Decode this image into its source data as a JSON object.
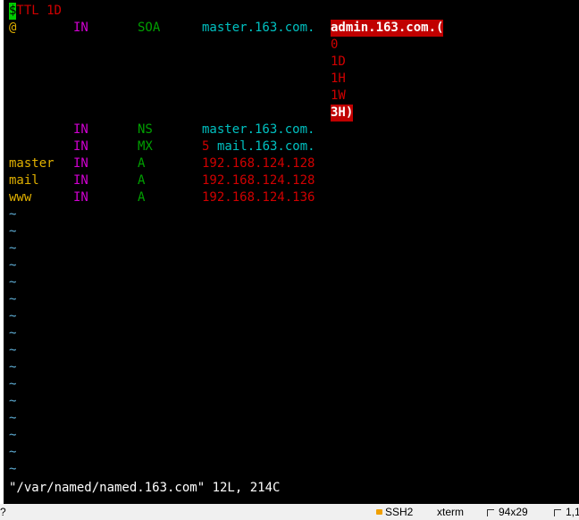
{
  "colors": {
    "background": "#000000",
    "yellow": "#e0b000",
    "magenta": "#d000d0",
    "green": "#00a000",
    "cyan": "#00c0c0",
    "red": "#d00000",
    "tilde": "#5fafd7",
    "cursor": "#00cc00",
    "highlight_bg": "#c00000"
  },
  "editor": {
    "ttl_cursor_char": "$",
    "ttl_rest": "TTL 1D",
    "soa": {
      "name": "@",
      "class": "IN",
      "type": "SOA",
      "primary_ns": "master.163.com.",
      "admin": "admin.163.com.(",
      "serial": "0",
      "refresh": "1D",
      "retry": "1H",
      "expire": "1W",
      "minimum": "3H)"
    },
    "records": [
      {
        "name": "",
        "class": "IN",
        "type": "NS",
        "value": "master.163.com."
      },
      {
        "name": "",
        "class": "IN",
        "type": "MX",
        "priority": "5",
        "value": "mail.163.com."
      },
      {
        "name": "master",
        "class": "IN",
        "type": "A",
        "value": "192.168.124.128"
      },
      {
        "name": "mail",
        "class": "IN",
        "type": "A",
        "value": "192.168.124.128"
      },
      {
        "name": "www",
        "class": "IN",
        "type": "A",
        "value": "192.168.124.136"
      }
    ],
    "tilde_char": "~",
    "command_line": "\"/var/named/named.163.com\" 12L, 214C"
  },
  "statusbar": {
    "left_char": "?",
    "protocol": "SSH2",
    "terminal": "xterm",
    "size": "94x29",
    "position": "1,1"
  }
}
